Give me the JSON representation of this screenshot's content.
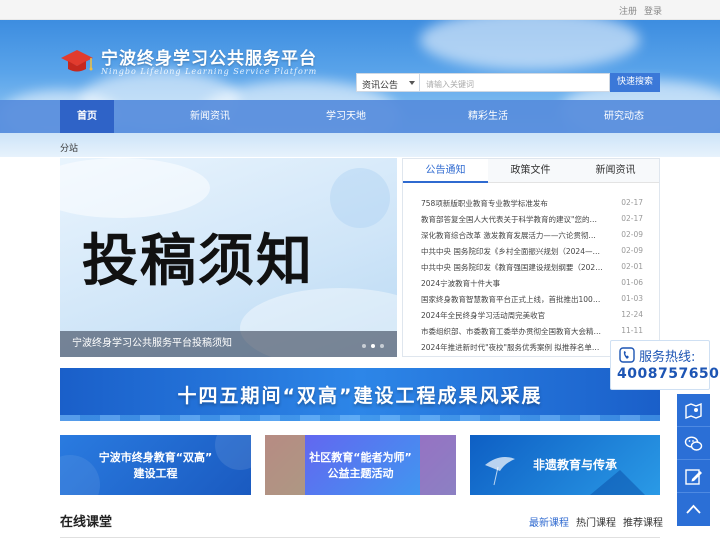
{
  "topbar": {
    "register": "注册",
    "login": "登录"
  },
  "logo": {
    "title": "宁波终身学习公共服务平台",
    "subtitle": "Ningbo Lifelong Learning Service Platform"
  },
  "search": {
    "category": "资讯公告",
    "placeholder": "请输入关键词",
    "button": "快速搜索"
  },
  "nav": {
    "items": [
      "首页",
      "新闻资讯",
      "学习天地",
      "精彩生活",
      "研究动态"
    ],
    "active": 0
  },
  "breadcrumb": "分站",
  "banner": {
    "headline": "投稿须知",
    "caption": "宁波终身学习公共服务平台投稿须知"
  },
  "panel": {
    "tabs": [
      "公告通知",
      "政策文件",
      "新闻资讯"
    ],
    "active_tab": 0,
    "items": [
      {
        "title": "758项新版职业教育专业教学标准发布",
        "date": "02-17"
      },
      {
        "title": "教育部答复全国人大代表关于科学教育的建议\"您的建议...",
        "date": "02-17"
      },
      {
        "title": "深化教育综合改革 激发教育发展活力——六论贯彻落实...",
        "date": "02-09"
      },
      {
        "title": "中共中央 国务院印发《乡村全面振兴规划（2024—202...",
        "date": "02-09"
      },
      {
        "title": "中共中央 国务院印发《教育强国建设规划纲要（2024—...",
        "date": "02-01"
      },
      {
        "title": "2024宁波教育十件大事",
        "date": "01-06"
      },
      {
        "title": "国家终身教育智慧教育平台正式上线，首批推出1000门...",
        "date": "01-03"
      },
      {
        "title": "2024年全民终身学习活动周完美收官",
        "date": "12-24"
      },
      {
        "title": "市委组织部、市委教育工委举办贯彻全国教育大会精神...",
        "date": "11-11"
      },
      {
        "title": "2024年推进新时代\"夜校\"服务优秀案例 拟推荐名单公示",
        "date": ""
      }
    ]
  },
  "feature_banner": "十四五期间“双高”建设工程成果风采展",
  "cards": [
    {
      "line1": "宁波市终身教育“双高”",
      "line2": "建设工程"
    },
    {
      "line1": "社区教育“能者为师”",
      "line2": "公益主题活动"
    },
    {
      "line1": "非遗教育与传承",
      "line2": ""
    }
  ],
  "courses": {
    "title": "在线课堂",
    "tabs": [
      "最新课程",
      "热门课程",
      "推荐课程"
    ],
    "active_tab": 0
  },
  "hotline": {
    "label": "服务热线:",
    "number": "4008757650"
  },
  "side_icons": [
    "map-icon",
    "wechat-icon",
    "edit-icon",
    "back-to-top-icon"
  ],
  "colors": {
    "primary": "#2b6fd6",
    "nav": "#568cdc",
    "nav_active": "#2f63c7",
    "accent": "#2f6ad0"
  }
}
